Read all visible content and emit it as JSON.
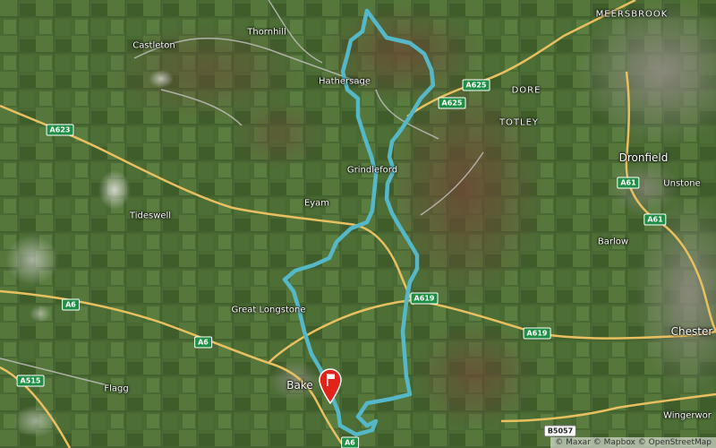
{
  "map": {
    "places": [
      {
        "id": "meersbrook",
        "label": "MEERSBROOK"
      },
      {
        "id": "castleton",
        "label": "Castleton"
      },
      {
        "id": "thornhill",
        "label": "Thornhill"
      },
      {
        "id": "hathersage",
        "label": "Hathersage"
      },
      {
        "id": "dore",
        "label": "DORE"
      },
      {
        "id": "totley",
        "label": "TOTLEY"
      },
      {
        "id": "grindleford",
        "label": "Grindleford"
      },
      {
        "id": "dronfield",
        "label": "Dronfield"
      },
      {
        "id": "unstone",
        "label": "Unstone"
      },
      {
        "id": "tideswell",
        "label": "Tideswell"
      },
      {
        "id": "eyam",
        "label": "Eyam"
      },
      {
        "id": "barlow",
        "label": "Barlow"
      },
      {
        "id": "great_longstone",
        "label": "Great Longstone"
      },
      {
        "id": "chesterfield",
        "label": "Chester"
      },
      {
        "id": "bakewell",
        "label": "Bake"
      },
      {
        "id": "flagg",
        "label": "Flagg"
      },
      {
        "id": "wingerworth",
        "label": "Wingerwor"
      }
    ],
    "roads": [
      {
        "id": "a625_top",
        "label": "A625"
      },
      {
        "id": "a625_mid",
        "label": "A625"
      },
      {
        "id": "a623",
        "label": "A623"
      },
      {
        "id": "a61_top",
        "label": "A61"
      },
      {
        "id": "a61_mid",
        "label": "A61"
      },
      {
        "id": "a619_west",
        "label": "A619"
      },
      {
        "id": "a619_east",
        "label": "A619"
      },
      {
        "id": "a6_west",
        "label": "A6"
      },
      {
        "id": "a6_mid",
        "label": "A6"
      },
      {
        "id": "a6_south",
        "label": "A6"
      },
      {
        "id": "a515",
        "label": "A515"
      },
      {
        "id": "b5057",
        "label": "B5057"
      }
    ],
    "route_color": "#55b8c8",
    "marker_color": "#e2231a",
    "attribution": "© Maxar © Mapbox © OpenStreetMap"
  }
}
